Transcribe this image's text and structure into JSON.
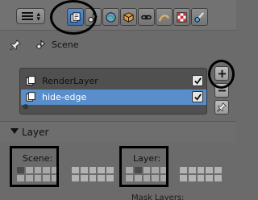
{
  "header": {
    "editor_type_icon": "properties-editor-icon",
    "context_tabs": [
      {
        "icon": "render-icon",
        "active": false
      },
      {
        "icon": "render-layers-icon",
        "active": true
      },
      {
        "icon": "scene-icon",
        "active": false
      },
      {
        "icon": "world-icon",
        "active": false
      },
      {
        "icon": "object-icon",
        "active": false
      },
      {
        "icon": "constraints-icon",
        "active": false
      },
      {
        "icon": "modifiers-icon",
        "active": false
      },
      {
        "icon": "texture-icon",
        "active": false
      },
      {
        "icon": "brush-icon",
        "active": false
      }
    ]
  },
  "context": {
    "label": "Scene"
  },
  "render_layers": {
    "items": [
      {
        "label": "RenderLayer",
        "checked": true,
        "selected": false
      },
      {
        "label": "hide-edge",
        "checked": true,
        "selected": true
      }
    ]
  },
  "layer_panel": {
    "title": "Layer",
    "scene_label": "Scene:",
    "layer_label": "Layer:",
    "bottom_label": "Mask Layers:"
  },
  "colors": {
    "selected": "#5a8ecb",
    "background": "#6b6b6b",
    "annotation": "#000000"
  }
}
